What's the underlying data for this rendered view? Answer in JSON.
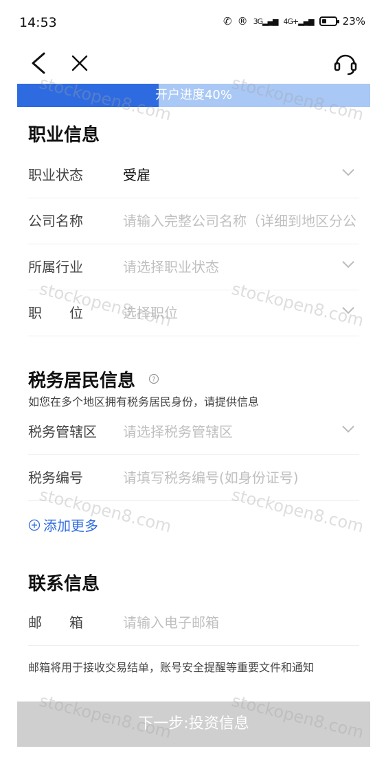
{
  "status_bar": {
    "time": "14:53",
    "signal_3g": "3G",
    "signal_4g": "4G+",
    "battery": "23%"
  },
  "progress": {
    "label": "开户进度40%",
    "percent": 40
  },
  "occupation": {
    "title": "职业信息",
    "rows": [
      {
        "label": "职业状态",
        "value": "受雇",
        "placeholder": ""
      },
      {
        "label": "公司名称",
        "value": "",
        "placeholder": "请输入完整公司名称（详细到地区分公"
      },
      {
        "label": "所属行业",
        "value": "",
        "placeholder": "请选择职业状态"
      },
      {
        "label": "职　　位",
        "value": "",
        "placeholder": "选择职位"
      }
    ]
  },
  "tax": {
    "title": "税务居民信息",
    "subtitle": "如您在多个地区拥有税务居民身份，请提供信息",
    "rows": [
      {
        "label": "税务管辖区",
        "placeholder": "请选择税务管辖区"
      },
      {
        "label": "税务编号",
        "placeholder": "请填写税务编号(如身份证号)"
      }
    ],
    "add_more": "添加更多"
  },
  "contact": {
    "title": "联系信息",
    "email_label": "邮　　箱",
    "email_placeholder": "请输入电子邮箱",
    "note": "邮箱将用于接收交易结单，账号安全提醒等重要文件和通知"
  },
  "next_button": "下一步:投资信息",
  "watermark": "stockopen8.com",
  "colors": {
    "accent": "#2f6be0",
    "progress_bg": "#a9c8f5",
    "button_disabled": "#cfcfcf"
  },
  "icons": [
    "back-arrow-icon",
    "close-icon",
    "customer-service-headset-icon",
    "chevron-down-icon",
    "help-circle-icon",
    "add-circle-icon"
  ]
}
